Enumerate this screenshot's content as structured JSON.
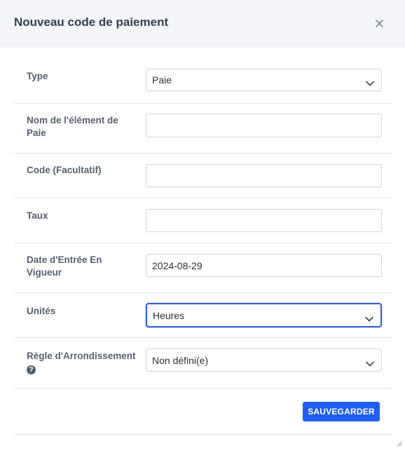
{
  "modal": {
    "title": "Nouveau code de paiement"
  },
  "fields": {
    "type": {
      "label": "Type",
      "value": "Paie"
    },
    "nom": {
      "label_line1": "Nom de l'élément de",
      "label_line2": "Paie",
      "value": ""
    },
    "code": {
      "label": "Code (Facultatif)",
      "value": ""
    },
    "taux": {
      "label": "Taux",
      "value": ""
    },
    "date": {
      "label_line1": "Date d'Entrée En",
      "label_line2": "Vigueur",
      "value": "2024-08-29"
    },
    "unites": {
      "label": "Unités",
      "value": "Heures"
    },
    "regle": {
      "label": "Règle d'Arrondissement",
      "help": "?",
      "value": "Non défini(e)"
    }
  },
  "actions": {
    "save_label": "SAUVEGARDER"
  },
  "icons": {
    "close": "close-icon",
    "dropdown": "chevron-down-icon",
    "help": "help-icon",
    "resize": "resize-handle-icon"
  },
  "colors": {
    "header_bg": "#f3f5f9",
    "primary": "#1f5ef0",
    "focus_border": "#2f5fd6"
  }
}
